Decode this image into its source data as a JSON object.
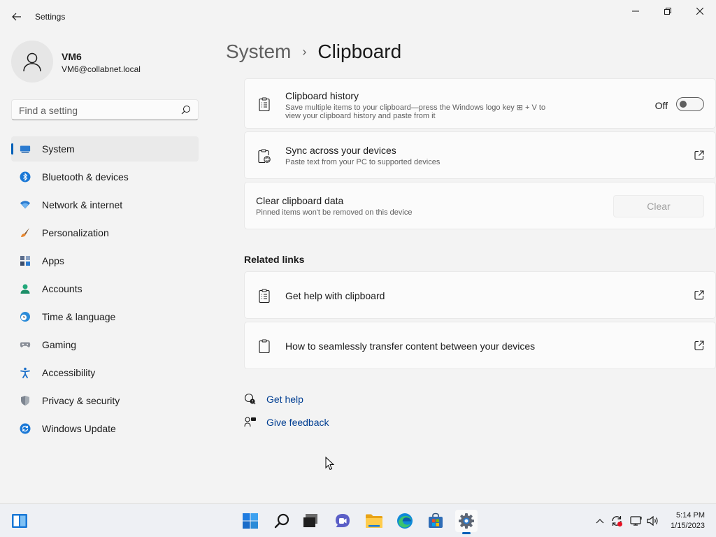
{
  "window": {
    "title": "Settings"
  },
  "profile": {
    "name": "VM6",
    "email": "VM6@collabnet.local"
  },
  "search": {
    "placeholder": "Find a setting"
  },
  "nav": {
    "items": [
      {
        "label": "System",
        "icon": "system-icon",
        "active": true
      },
      {
        "label": "Bluetooth & devices",
        "icon": "bluetooth-icon"
      },
      {
        "label": "Network & internet",
        "icon": "wifi-icon"
      },
      {
        "label": "Personalization",
        "icon": "brush-icon"
      },
      {
        "label": "Apps",
        "icon": "apps-icon"
      },
      {
        "label": "Accounts",
        "icon": "person-icon"
      },
      {
        "label": "Time & language",
        "icon": "globe-clock-icon"
      },
      {
        "label": "Gaming",
        "icon": "gamepad-icon"
      },
      {
        "label": "Accessibility",
        "icon": "accessibility-icon"
      },
      {
        "label": "Privacy & security",
        "icon": "shield-icon"
      },
      {
        "label": "Windows Update",
        "icon": "update-icon"
      }
    ]
  },
  "breadcrumb": {
    "parent": "System",
    "separator": "›",
    "current": "Clipboard"
  },
  "clipboard_history": {
    "title": "Clipboard history",
    "desc_line1": "Save multiple items to your clipboard—press the Windows logo key ⊞ + V to",
    "desc_line2": "view your clipboard history and paste from it",
    "toggle_label": "Off",
    "toggle_on": false
  },
  "sync": {
    "title": "Sync across your devices",
    "desc": "Paste text from your PC to supported devices"
  },
  "clear_data": {
    "title": "Clear clipboard data",
    "desc": "Pinned items won't be removed on this device",
    "button_label": "Clear",
    "button_enabled": false
  },
  "related": {
    "header": "Related links",
    "links": [
      {
        "label": "Get help with clipboard"
      },
      {
        "label": "How to seamlessly transfer content between your devices"
      }
    ]
  },
  "help": {
    "get_help": "Get help",
    "give_feedback": "Give feedback"
  },
  "taskbar": {
    "apps": [
      "widgets-icon",
      "start-icon",
      "search-icon",
      "task-view-icon",
      "chat-icon",
      "file-explorer-icon",
      "edge-icon",
      "store-icon",
      "settings-icon"
    ],
    "clock_time": "5:14 PM",
    "clock_date": "1/15/2023"
  },
  "colors": {
    "accent": "#005fb8",
    "link": "#003e92",
    "background": "#f3f3f3",
    "card": "#fbfbfb"
  }
}
